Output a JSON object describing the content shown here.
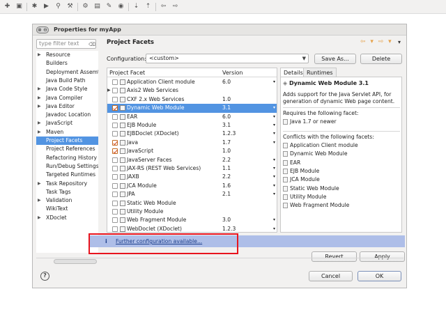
{
  "toolbar_icons": [
    "new-icon",
    "save-icon",
    "debug-icon",
    "run-icon",
    "search-icon",
    "build-icon",
    "tools-icon",
    "open-icon",
    "refactor-icon",
    "open-type-icon",
    "next-annotation-icon",
    "prev-annotation-icon",
    "back-icon",
    "forward-icon"
  ],
  "dialog": {
    "title": "Properties for myApp",
    "window_button": "⊗ ⊖"
  },
  "filter": {
    "placeholder": "type filter text",
    "clear_icon": "⌫"
  },
  "tree": [
    {
      "label": "Resource",
      "expander": "▶",
      "selected": false
    },
    {
      "label": "Builders",
      "expander": "",
      "selected": false
    },
    {
      "label": "Deployment Assemt",
      "expander": "",
      "selected": false
    },
    {
      "label": "Java Build Path",
      "expander": "",
      "selected": false
    },
    {
      "label": "Java Code Style",
      "expander": "▶",
      "selected": false
    },
    {
      "label": "Java Compiler",
      "expander": "▶",
      "selected": false
    },
    {
      "label": "Java Editor",
      "expander": "▶",
      "selected": false
    },
    {
      "label": "Javadoc Location",
      "expander": "",
      "selected": false
    },
    {
      "label": "JavaScript",
      "expander": "▶",
      "selected": false
    },
    {
      "label": "Maven",
      "expander": "▶",
      "selected": false
    },
    {
      "label": "Project Facets",
      "expander": "",
      "selected": true
    },
    {
      "label": "Project References",
      "expander": "",
      "selected": false
    },
    {
      "label": "Refactoring History",
      "expander": "",
      "selected": false
    },
    {
      "label": "Run/Debug Settings",
      "expander": "",
      "selected": false
    },
    {
      "label": "Targeted Runtimes",
      "expander": "",
      "selected": false
    },
    {
      "label": "Task Repository",
      "expander": "▶",
      "selected": false
    },
    {
      "label": "Task Tags",
      "expander": "",
      "selected": false
    },
    {
      "label": "Validation",
      "expander": "▶",
      "selected": false
    },
    {
      "label": "WikiText",
      "expander": "",
      "selected": false
    },
    {
      "label": "XDoclet",
      "expander": "▶",
      "selected": false
    }
  ],
  "page": {
    "title": "Project Facets",
    "nav_arrows": "⇦ ▾ ⇨ ▾",
    "nav_menu": "▾"
  },
  "configuration": {
    "label": "Configuration:",
    "value": "<custom>",
    "save_as": "Save As...",
    "delete": "Delete"
  },
  "facet_table": {
    "col_facet": "Project Facet",
    "col_version": "Version",
    "rows": [
      {
        "name": "Application Client module",
        "version": "6.0",
        "checked": false,
        "selected": false,
        "expander": "",
        "dropdown": "▾"
      },
      {
        "name": "Axis2 Web Services",
        "version": "",
        "checked": false,
        "selected": false,
        "expander": "▶",
        "dropdown": ""
      },
      {
        "name": "CXF 2.x Web Services",
        "version": "1.0",
        "checked": false,
        "selected": false,
        "expander": "",
        "dropdown": ""
      },
      {
        "name": "Dynamic Web Module",
        "version": "3.1",
        "checked": true,
        "selected": true,
        "expander": "",
        "dropdown": "▾"
      },
      {
        "name": "EAR",
        "version": "6.0",
        "checked": false,
        "selected": false,
        "expander": "",
        "dropdown": "▾"
      },
      {
        "name": "EJB Module",
        "version": "3.1",
        "checked": false,
        "selected": false,
        "expander": "",
        "dropdown": "▾"
      },
      {
        "name": "EJBDoclet (XDoclet)",
        "version": "1.2.3",
        "checked": false,
        "selected": false,
        "expander": "",
        "dropdown": "▾"
      },
      {
        "name": "Java",
        "version": "1.7",
        "checked": true,
        "selected": false,
        "expander": "",
        "dropdown": "▾"
      },
      {
        "name": "JavaScript",
        "version": "1.0",
        "checked": true,
        "selected": false,
        "expander": "",
        "dropdown": ""
      },
      {
        "name": "JavaServer Faces",
        "version": "2.2",
        "checked": false,
        "selected": false,
        "expander": "",
        "dropdown": "▾"
      },
      {
        "name": "JAX-RS (REST Web Services)",
        "version": "1.1",
        "checked": false,
        "selected": false,
        "expander": "",
        "dropdown": "▾"
      },
      {
        "name": "JAXB",
        "version": "2.2",
        "checked": false,
        "selected": false,
        "expander": "",
        "dropdown": "▾"
      },
      {
        "name": "JCA Module",
        "version": "1.6",
        "checked": false,
        "selected": false,
        "expander": "",
        "dropdown": "▾"
      },
      {
        "name": "JPA",
        "version": "2.1",
        "checked": false,
        "selected": false,
        "expander": "",
        "dropdown": "▾"
      },
      {
        "name": "Static Web Module",
        "version": "",
        "checked": false,
        "selected": false,
        "expander": "",
        "dropdown": ""
      },
      {
        "name": "Utility Module",
        "version": "",
        "checked": false,
        "selected": false,
        "expander": "",
        "dropdown": ""
      },
      {
        "name": "Web Fragment Module",
        "version": "3.0",
        "checked": false,
        "selected": false,
        "expander": "",
        "dropdown": "▾"
      },
      {
        "name": "WebDoclet (XDoclet)",
        "version": "1.2.3",
        "checked": false,
        "selected": false,
        "expander": "",
        "dropdown": "▾"
      }
    ]
  },
  "details": {
    "tab_details": "Details",
    "tab_runtimes": "Runtimes",
    "facet_title": "Dynamic Web Module 3.1",
    "description": "Adds support for the Java Servlet API, for generation of dynamic Web page content.",
    "requires_heading": "Requires the following facet:",
    "requires": [
      "Java 1.7 or newer"
    ],
    "conflicts_heading": "Conflicts with the following facets:",
    "conflicts": [
      "Application Client module",
      "Dynamic Web Module",
      "EAR",
      "EJB Module",
      "JCA Module",
      "Static Web Module",
      "Utility Module",
      "Web Fragment Module"
    ]
  },
  "info": {
    "icon": "i",
    "link": "Further configuration available..."
  },
  "buttons": {
    "revert": "Revert",
    "apply": "Apply",
    "cancel": "Cancel",
    "ok": "OK",
    "help": "?"
  }
}
